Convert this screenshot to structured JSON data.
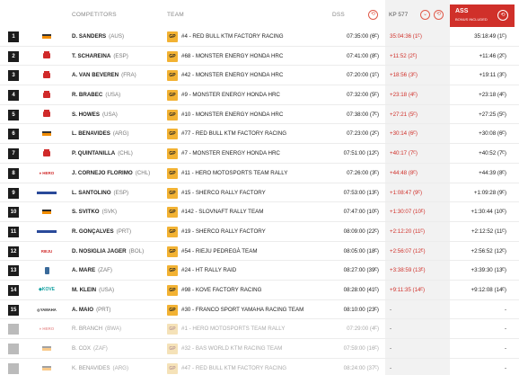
{
  "header": {
    "competitors": "COMPETITORS",
    "team": "TEAM",
    "dss": "DSS",
    "kp": "KP 577",
    "ass": "ASS",
    "ass_sub": "BONUS INCLUDED"
  },
  "rows": [
    {
      "pos": "1",
      "logo": "red-bull-ktm-logo",
      "name": "D. SANDERS",
      "country": "(AUS)",
      "badge": "GP",
      "team": "#4 - RED BULL KTM FACTORY RACING",
      "dss": "07:35:00 (6ᴱ)",
      "kp": "35:04:36 (1ᴱ)",
      "ass": "35:18:49 (1ᴱ)"
    },
    {
      "pos": "2",
      "logo": "honda-logo",
      "name": "T. SCHAREINA",
      "country": "(ESP)",
      "badge": "GP",
      "team": "#68 - MONSTER ENERGY HONDA HRC",
      "dss": "07:41:00 (8ᴱ)",
      "kp": "+11:52 (2ᴱ)",
      "ass": "+11:46 (2ᴱ)"
    },
    {
      "pos": "3",
      "logo": "honda-logo",
      "name": "A. VAN BEVEREN",
      "country": "(FRA)",
      "badge": "GP",
      "team": "#42 - MONSTER ENERGY HONDA HRC",
      "dss": "07:20:00 (1ᴱ)",
      "kp": "+18:56 (3ᴱ)",
      "ass": "+19:11 (3ᴱ)"
    },
    {
      "pos": "4",
      "logo": "honda-logo",
      "name": "R. BRABEC",
      "country": "(USA)",
      "badge": "GP",
      "team": "#9 - MONSTER ENERGY HONDA HRC",
      "dss": "07:32:00 (5ᴱ)",
      "kp": "+23:18 (4ᴱ)",
      "ass": "+23:18 (4ᴱ)"
    },
    {
      "pos": "5",
      "logo": "honda-logo",
      "name": "S. HOWES",
      "country": "(USA)",
      "badge": "GP",
      "team": "#10 - MONSTER ENERGY HONDA HRC",
      "dss": "07:38:00 (7ᴱ)",
      "kp": "+27:21 (5ᴱ)",
      "ass": "+27:25 (5ᴱ)"
    },
    {
      "pos": "6",
      "logo": "red-bull-ktm-logo",
      "name": "L. BENAVIDES",
      "country": "(ARG)",
      "badge": "GP",
      "team": "#77 - RED BULL KTM FACTORY RACING",
      "dss": "07:23:00 (2ᴱ)",
      "kp": "+30:14 (6ᴱ)",
      "ass": "+30:08 (6ᴱ)"
    },
    {
      "pos": "7",
      "logo": "honda-logo",
      "name": "P. QUINTANILLA",
      "country": "(CHL)",
      "badge": "GP",
      "team": "#7 - MONSTER ENERGY HONDA HRC",
      "dss": "07:51:00 (12ᴱ)",
      "kp": "+40:17 (7ᴱ)",
      "ass": "+40:52 (7ᴱ)"
    },
    {
      "pos": "8",
      "logo": "hero-logo",
      "name": "J. CORNEJO FLORIMO",
      "country": "(CHL)",
      "badge": "GP",
      "team": "#11 - HERO MOTOSPORTS TEAM RALLY",
      "dss": "07:26:00 (3ᴱ)",
      "kp": "+44:48 (8ᴱ)",
      "ass": "+44:39 (8ᴱ)"
    },
    {
      "pos": "9",
      "logo": "sherco-logo",
      "name": "L. SANTOLINO",
      "country": "(ESP)",
      "badge": "GP",
      "team": "#15 - SHERCO RALLY FACTORY",
      "dss": "07:53:00 (13ᴱ)",
      "kp": "+1:08:47 (9ᴱ)",
      "ass": "+1:09:28 (9ᴱ)"
    },
    {
      "pos": "10",
      "logo": "slovnaft-logo",
      "name": "S. SVITKO",
      "country": "(SVK)",
      "badge": "GP",
      "team": "#142 - SLOVNAFT RALLY TEAM",
      "dss": "07:47:00 (10ᴱ)",
      "kp": "+1:30:07 (10ᴱ)",
      "ass": "+1:30:44 (10ᴱ)"
    },
    {
      "pos": "11",
      "logo": "sherco-logo",
      "name": "R. GONÇALVES",
      "country": "(PRT)",
      "badge": "GP",
      "team": "#19 - SHERCO RALLY FACTORY",
      "dss": "08:09:00 (22ᴱ)",
      "kp": "+2:12:20 (11ᴱ)",
      "ass": "+2:12:52 (11ᴱ)"
    },
    {
      "pos": "12",
      "logo": "rieju-logo",
      "name": "D. NOSIGLIA JAGER",
      "country": "(BOL)",
      "badge": "GP",
      "team": "#54 - RIEJU PEDREGÀ TEAM",
      "dss": "08:05:00 (18ᴱ)",
      "kp": "+2:56:07 (12ᴱ)",
      "ass": "+2:56:52 (12ᴱ)"
    },
    {
      "pos": "13",
      "logo": "ht-rally-logo",
      "name": "A. MARE",
      "country": "(ZAF)",
      "badge": "GP",
      "team": "#24 - HT RALLY RAID",
      "dss": "08:27:00 (39ᴱ)",
      "kp": "+3:38:59 (13ᴱ)",
      "ass": "+3:39:30 (13ᴱ)"
    },
    {
      "pos": "14",
      "logo": "kove-logo",
      "name": "M. KLEIN",
      "country": "(USA)",
      "badge": "GP",
      "team": "#98 - KOVE FACTORY RACING",
      "dss": "08:28:00 (41ᴱ)",
      "kp": "+9:11:35 (14ᴱ)",
      "ass": "+9:12:08 (14ᴱ)"
    },
    {
      "pos": "15",
      "logo": "yamaha-logo",
      "name": "A. MAIO",
      "country": "(PRT)",
      "badge": "GP",
      "team": "#30 - FRANCO SPORT YAMAHA RACING TEAM",
      "dss": "08:10:00 (23ᴱ)",
      "kp": "-",
      "ass": "-"
    },
    {
      "pos": "",
      "logo": "hero-logo",
      "name": "R. BRANCH",
      "country": "(BWA)",
      "badge": "GP",
      "team": "#1 - HERO MOTOSPORTS TEAM RALLY",
      "dss": "07:29:00 (4ᴱ)",
      "kp": "-",
      "ass": "-",
      "dim": true
    },
    {
      "pos": "",
      "logo": "red-bull-ktm-logo",
      "name": "B. COX",
      "country": "(ZAF)",
      "badge": "GP",
      "team": "#32 - BAS WORLD KTM RACING TEAM",
      "dss": "07:59:00 (16ᴱ)",
      "kp": "-",
      "ass": "-",
      "dim": true
    },
    {
      "pos": "",
      "logo": "red-bull-ktm-logo",
      "name": "K. BENAVIDES",
      "country": "(ARG)",
      "badge": "GP",
      "team": "#47 - RED BULL KTM FACTORY RACING",
      "dss": "08:24:00 (37ᴱ)",
      "kp": "-",
      "ass": "-",
      "dim": true
    }
  ]
}
